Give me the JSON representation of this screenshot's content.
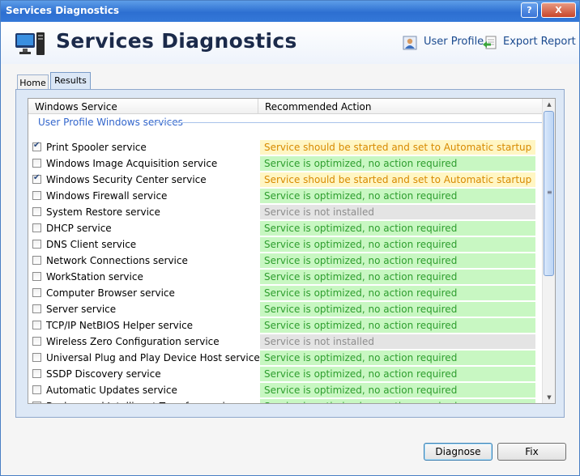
{
  "window": {
    "title": "Services Diagnostics",
    "help_glyph": "?",
    "close_glyph": "X"
  },
  "header": {
    "app_title": "Services Diagnostics",
    "app_icon": "computer-icon",
    "links": [
      {
        "label": "User Profile",
        "icon": "user-profile-icon"
      },
      {
        "label": "Export Report",
        "icon": "export-report-icon"
      }
    ]
  },
  "tabs": [
    {
      "label": "Home"
    },
    {
      "label": "Results",
      "selected": true
    }
  ],
  "list": {
    "columns": [
      "Windows Service",
      "Recommended Action"
    ],
    "group_label": "User Profile Windows services",
    "rows": [
      {
        "service": "Print Spooler service",
        "checked": true,
        "action": "Service should be started and set to Automatic startup",
        "status": "warn"
      },
      {
        "service": "Windows Image Acquisition service",
        "checked": false,
        "action": "Service is optimized, no action required",
        "status": "ok"
      },
      {
        "service": "Windows Security Center service",
        "checked": true,
        "action": "Service should be started and set to Automatic startup",
        "status": "warn"
      },
      {
        "service": "Windows Firewall service",
        "checked": false,
        "action": "Service is optimized, no action required",
        "status": "ok"
      },
      {
        "service": "System Restore service",
        "checked": false,
        "action": "Service is not installed",
        "status": "na"
      },
      {
        "service": "DHCP service",
        "checked": false,
        "action": "Service is optimized, no action required",
        "status": "ok"
      },
      {
        "service": "DNS Client service",
        "checked": false,
        "action": "Service is optimized, no action required",
        "status": "ok"
      },
      {
        "service": "Network Connections service",
        "checked": false,
        "action": "Service is optimized, no action required",
        "status": "ok"
      },
      {
        "service": "WorkStation service",
        "checked": false,
        "action": "Service is optimized, no action required",
        "status": "ok"
      },
      {
        "service": "Computer Browser service",
        "checked": false,
        "action": "Service is optimized, no action required",
        "status": "ok"
      },
      {
        "service": "Server service",
        "checked": false,
        "action": "Service is optimized, no action required",
        "status": "ok"
      },
      {
        "service": "TCP/IP NetBIOS Helper service",
        "checked": false,
        "action": "Service is optimized, no action required",
        "status": "ok"
      },
      {
        "service": "Wireless Zero Configuration service",
        "checked": false,
        "action": "Service is not installed",
        "status": "na"
      },
      {
        "service": "Universal Plug and Play Device Host service",
        "checked": false,
        "action": "Service is optimized, no action required",
        "status": "ok"
      },
      {
        "service": "SSDP Discovery service",
        "checked": false,
        "action": "Service is optimized, no action required",
        "status": "ok"
      },
      {
        "service": "Automatic Updates service",
        "checked": false,
        "action": "Service is optimized, no action required",
        "status": "ok"
      },
      {
        "service": "Background Intelligent Transfer service",
        "checked": false,
        "action": "Service is optimized, no action required",
        "status": "ok"
      }
    ]
  },
  "buttons": {
    "diagnose": "Diagnose",
    "fix": "Fix"
  },
  "colors": {
    "ok_bg": "#c8f7c2",
    "ok_text": "#2e9e2e",
    "warn_bg": "#fff6c4",
    "warn_text": "#d88a00",
    "na_bg": "#e4e4e4",
    "na_text": "#8d8d8d",
    "title_bar": "#2d6fd1"
  }
}
